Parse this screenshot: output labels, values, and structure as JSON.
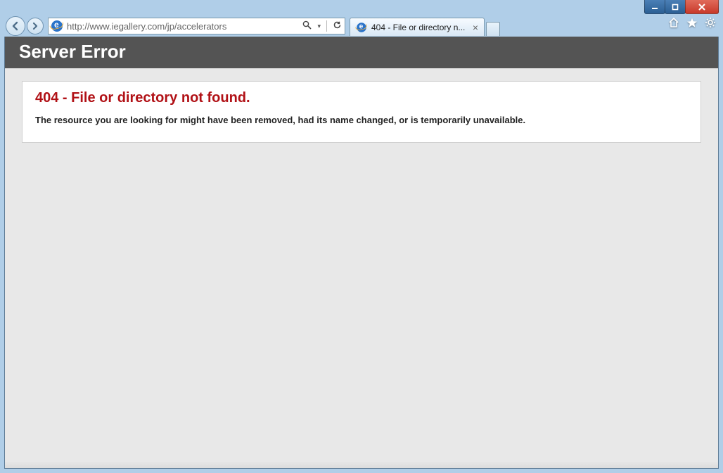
{
  "browser": {
    "url": "http://www.iegallery.com/jp/accelerators",
    "tab_title": "404 - File or directory n...",
    "search_dropdown_glyph": "▾"
  },
  "page": {
    "server_error_header": "Server Error",
    "error_title": "404 - File or directory not found.",
    "error_description": "The resource you are looking for might have been removed, had its name changed, or is temporarily unavailable."
  }
}
